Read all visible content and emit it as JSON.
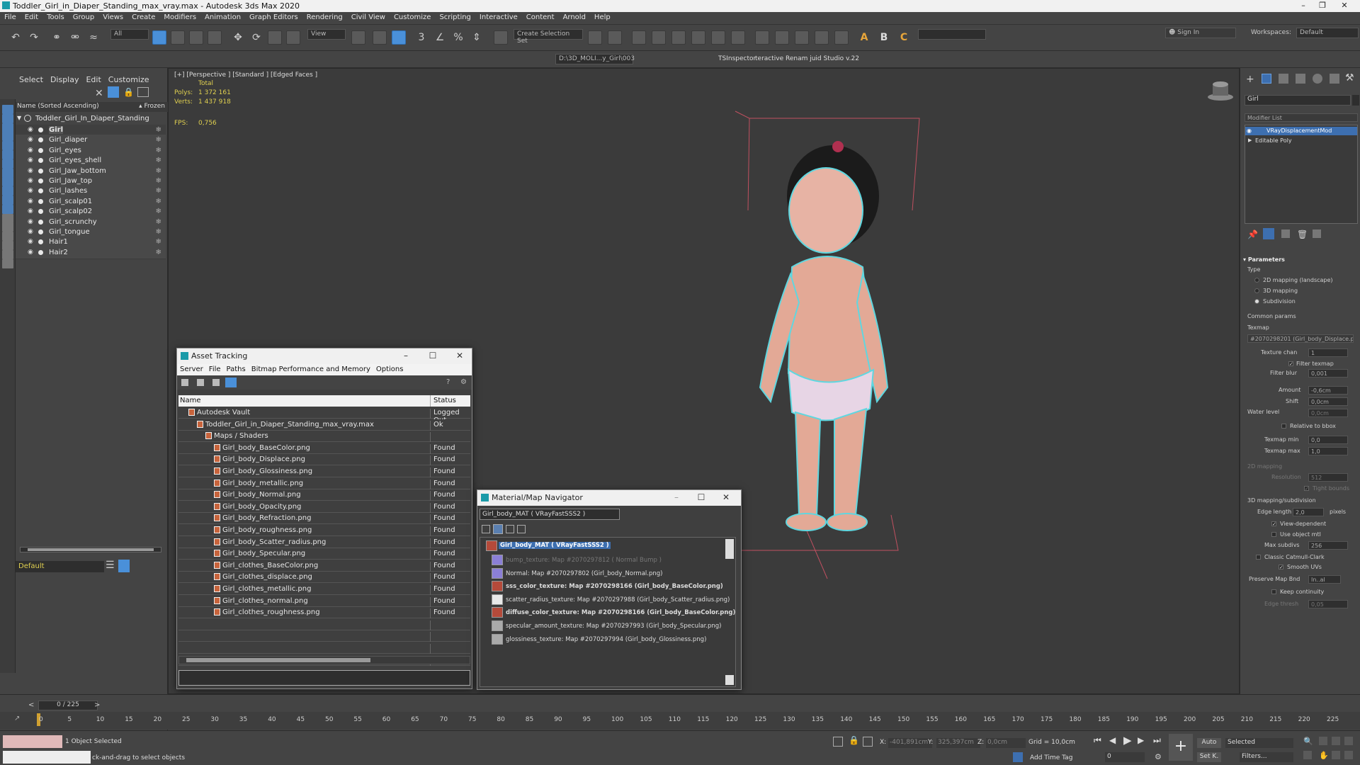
{
  "window": {
    "title": "Toddler_Girl_in_Diaper_Standing_max_vray.max - Autodesk 3ds Max 2020"
  },
  "menu": [
    "File",
    "Edit",
    "Tools",
    "Group",
    "Views",
    "Create",
    "Modifiers",
    "Animation",
    "Graph Editors",
    "Rendering",
    "Civil View",
    "Customize",
    "Scripting",
    "Interactive",
    "Content",
    "Arnold",
    "Help"
  ],
  "toolbar": {
    "filter": "All",
    "refcoord": "View",
    "selection_set": "Create Selection Set",
    "signin": "Sign In",
    "workspaces_label": "Workspaces:",
    "workspace": "Default",
    "project_path": "D:\\3D_MOLI...y_Girl\\003",
    "ts_inspector": "TSInspector",
    "renamer": "teractive Renam juid Studio v.22"
  },
  "scene_explorer": {
    "tabs": [
      "Select",
      "Display",
      "Edit",
      "Customize"
    ],
    "header": "Name (Sorted Ascending)",
    "frozen": "▴ Frozen",
    "root": "Toddler_Girl_In_Diaper_Standing",
    "items": [
      "Girl",
      "Girl_diaper",
      "Girl_eyes",
      "Girl_eyes_shell",
      "Girl_Jaw_bottom",
      "Girl_Jaw_top",
      "Girl_lashes",
      "Girl_scalp01",
      "Girl_scalp02",
      "Girl_scrunchy",
      "Girl_tongue",
      "Hair1",
      "Hair2"
    ],
    "layer": "Default",
    "frame_counter": "0 / 225"
  },
  "viewport": {
    "label": "[+] [Perspective ] [Standard ] [Edged Faces ]",
    "stats_total": "Total",
    "polys_label": "Polys:",
    "polys": "1 372 161",
    "verts_label": "Verts:",
    "verts": "1 437 918",
    "fps_label": "FPS:",
    "fps": "0,756"
  },
  "asset_tracking": {
    "title": "Asset Tracking",
    "menu": [
      "Server",
      "File",
      "Paths",
      "Bitmap Performance and Memory",
      "Options"
    ],
    "col_name": "Name",
    "col_status": "Status",
    "rows": [
      {
        "name": "Autodesk Vault",
        "status": "Logged Out",
        "indent": 1
      },
      {
        "name": "Toddler_Girl_in_Diaper_Standing_max_vray.max",
        "status": "Ok",
        "indent": 2
      },
      {
        "name": "Maps / Shaders",
        "status": "",
        "indent": 3
      },
      {
        "name": "Girl_body_BaseColor.png",
        "status": "Found",
        "indent": 4
      },
      {
        "name": "Girl_body_Displace.png",
        "status": "Found",
        "indent": 4
      },
      {
        "name": "Girl_body_Glossiness.png",
        "status": "Found",
        "indent": 4
      },
      {
        "name": "Girl_body_metallic.png",
        "status": "Found",
        "indent": 4
      },
      {
        "name": "Girl_body_Normal.png",
        "status": "Found",
        "indent": 4
      },
      {
        "name": "Girl_body_Opacity.png",
        "status": "Found",
        "indent": 4
      },
      {
        "name": "Girl_body_Refraction.png",
        "status": "Found",
        "indent": 4
      },
      {
        "name": "Girl_body_roughness.png",
        "status": "Found",
        "indent": 4
      },
      {
        "name": "Girl_body_Scatter_radius.png",
        "status": "Found",
        "indent": 4
      },
      {
        "name": "Girl_body_Specular.png",
        "status": "Found",
        "indent": 4
      },
      {
        "name": "Girl_clothes_BaseColor.png",
        "status": "Found",
        "indent": 4
      },
      {
        "name": "Girl_clothes_displace.png",
        "status": "Found",
        "indent": 4
      },
      {
        "name": "Girl_clothes_metallic.png",
        "status": "Found",
        "indent": 4
      },
      {
        "name": "Girl_clothes_normal.png",
        "status": "Found",
        "indent": 4
      },
      {
        "name": "Girl_clothes_roughness.png",
        "status": "Found",
        "indent": 4
      }
    ]
  },
  "material_navigator": {
    "title": "Material/Map Navigator",
    "field": "Girl_body_MAT  ( VRayFastSSS2 )",
    "root": "Girl_body_MAT  ( VRayFastSSS2 )",
    "items": [
      {
        "text": "bump_texture: Map #2070297812  ( Normal Bump )",
        "bold": false,
        "dim": true
      },
      {
        "text": "Normal: Map #2070297802 (Girl_body_Normal.png)",
        "bold": false,
        "dim": false
      },
      {
        "text": "sss_color_texture: Map #2070298166 (Girl_body_BaseColor.png)",
        "bold": true,
        "dim": false
      },
      {
        "text": "scatter_radius_texture: Map #2070297988 (Girl_body_Scatter_radius.png)",
        "bold": false,
        "dim": false
      },
      {
        "text": "diffuse_color_texture: Map #2070298166 (Girl_body_BaseColor.png)",
        "bold": true,
        "dim": false
      },
      {
        "text": "specular_amount_texture: Map #2070297993 (Girl_body_Specular.png)",
        "bold": false,
        "dim": false
      },
      {
        "text": "glossiness_texture: Map #2070297994 (Girl_body_Glossiness.png)",
        "bold": false,
        "dim": false
      }
    ]
  },
  "command_panel": {
    "object_name": "Girl",
    "modifier_list": "Modifier List",
    "stack": [
      "VRayDisplacementMod",
      "Editable Poly"
    ],
    "parameters": "Parameters",
    "type_label": "Type",
    "type_options": [
      "2D mapping (landscape)",
      "3D mapping",
      "Subdivision"
    ],
    "common_params": "Common params",
    "texmap_label": "Texmap",
    "texmap": "#2070298201 (Girl_body_Displace.p",
    "texture_chan_label": "Texture chan",
    "texture_chan": "1",
    "filter_texmap": "Filter texmap",
    "filter_blur_label": "Filter blur",
    "filter_blur": "0,001",
    "amount_label": "Amount",
    "amount": "-0,6cm",
    "shift_label": "Shift",
    "shift": "0,0cm",
    "water_level_label": "Water level",
    "water_level": "0,0cm",
    "relative_bbox": "Relative to bbox",
    "texmap_min_label": "Texmap min",
    "texmap_min": "0,0",
    "texmap_max_label": "Texmap max",
    "texmap_max": "1,0",
    "mapping2d": "2D mapping",
    "resolution_label": "Resolution",
    "resolution": "512",
    "tight_bounds": "Tight bounds",
    "mapping3d": "3D mapping/subdivision",
    "edge_length_label": "Edge length",
    "edge_length": "2,0",
    "pixels": "pixels",
    "view_dependent": "View-dependent",
    "use_object_mtl": "Use object mtl",
    "max_subdivs_label": "Max subdivs",
    "max_subdivs": "256",
    "classic_catmull": "Classic Catmull-Clark",
    "smooth_uvs": "Smooth UVs",
    "preserve_map_bnd_label": "Preserve Map Bnd",
    "preserve_map_bnd": "In..al",
    "keep_continuity": "Keep continuity",
    "edge_thresh_label": "Edge thresh",
    "edge_thresh": "0,05"
  },
  "timeline": {
    "ticks": [
      "0",
      "5",
      "10",
      "15",
      "20",
      "25",
      "30",
      "35",
      "40",
      "45",
      "50",
      "55",
      "60",
      "65",
      "70",
      "75",
      "80",
      "85",
      "90",
      "95",
      "100",
      "105",
      "110",
      "115",
      "120",
      "125",
      "130",
      "135",
      "140",
      "145",
      "150",
      "155",
      "160",
      "165",
      "170",
      "175",
      "180",
      "185",
      "190",
      "195",
      "200",
      "205",
      "210",
      "215",
      "220",
      "225"
    ]
  },
  "status": {
    "selected": "1 Object Selected",
    "hint": "ck-and-drag to select objects",
    "x_label": "X:",
    "x": "-401,891cm",
    "y_label": "Y:",
    "y": "325,397cm",
    "z_label": "Z:",
    "z": "0,0cm",
    "grid": "Grid = 10,0cm",
    "add_time_tag": "Add Time Tag",
    "auto": "Auto",
    "selected_mode": "Selected",
    "setk": "Set K.",
    "filters": "Filters...",
    "frame": "0"
  }
}
